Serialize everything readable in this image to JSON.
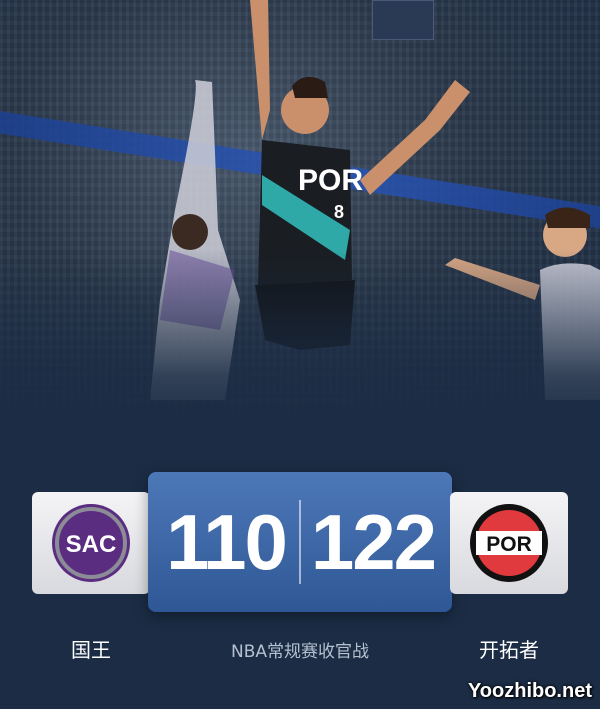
{
  "game": {
    "label": "NBA常规赛收官战",
    "home_team": {
      "abbr": "SAC",
      "name": "国王",
      "color": "#5a2d81",
      "score": "110"
    },
    "away_team": {
      "abbr": "POR",
      "name": "开拓者",
      "color": "#e03a3e",
      "score": "122"
    }
  },
  "photo": {
    "jersey_text": "POR",
    "jersey_number": "8"
  },
  "watermark": "Yoozhibo.net"
}
